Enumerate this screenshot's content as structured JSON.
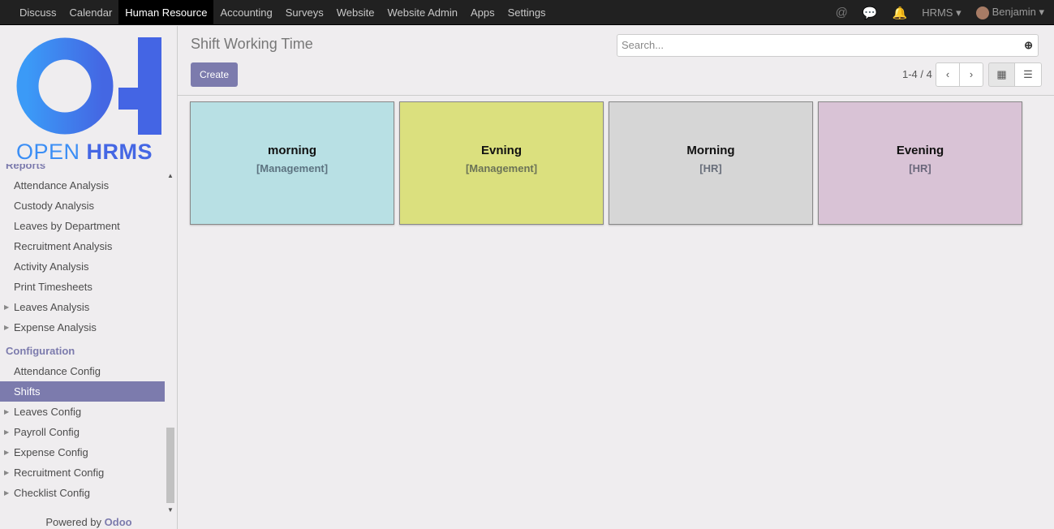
{
  "topbar": {
    "menu": [
      "Discuss",
      "Calendar",
      "Human Resource",
      "Accounting",
      "Surveys",
      "Website",
      "Website Admin",
      "Apps",
      "Settings"
    ],
    "active": "Human Resource",
    "company": "HRMS",
    "user": "Benjamin",
    "icons": [
      "at-icon",
      "chat-icon",
      "bell-icon"
    ]
  },
  "logo": {
    "text_light": "OPEN",
    "text_bold": "HRMS"
  },
  "sidebar": {
    "partial_header": "Reports",
    "reports": [
      "Attendance Analysis",
      "Custody Analysis",
      "Leaves by Department",
      "Recruitment Analysis",
      "Activity Analysis",
      "Print Timesheets",
      "Leaves Analysis",
      "Expense Analysis"
    ],
    "config_header": "Configuration",
    "config": [
      "Attendance Config",
      "Shifts",
      "Leaves Config",
      "Payroll Config",
      "Expense Config",
      "Recruitment Config",
      "Checklist Config"
    ],
    "selected": "Shifts",
    "powered_by": "Powered by",
    "odoo": "Odoo"
  },
  "control": {
    "title": "Shift Working Time",
    "create": "Create",
    "search_placeholder": "Search...",
    "pager": "1-4 / 4"
  },
  "cards": [
    {
      "name": "morning",
      "dept": "[Management]",
      "color": "#b8e0e4"
    },
    {
      "name": "Evning",
      "dept": "[Management]",
      "color": "#dbe07e"
    },
    {
      "name": "Morning",
      "dept": "[HR]",
      "color": "#d6d6d6"
    },
    {
      "name": "Evening",
      "dept": "[HR]",
      "color": "#d9c3d6"
    }
  ]
}
